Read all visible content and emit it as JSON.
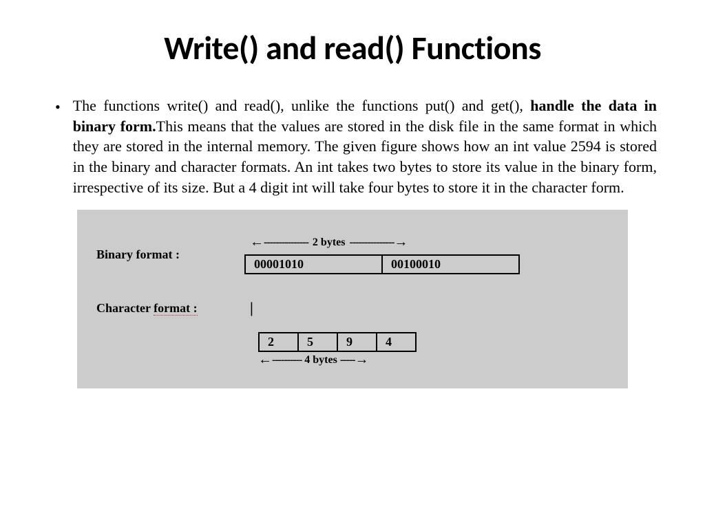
{
  "title": "Write() and read() Functions",
  "bullet": {
    "text_start": "The functions write() and read(), unlike the functions put() and get(), ",
    "text_bold": "handle the data in binary form.",
    "text_end": "This means that the values are stored in the disk file in the same format in which they are stored in the internal memory.  The given figure  shows how an int value 2594 is stored in the binary and character formats. An int takes two bytes to store its value in the binary form, irrespective of its size. But a 4 digit int will take four bytes to store it in the character form."
  },
  "figure": {
    "binary_label": "Binary format   :",
    "binary_arrow_text": "2 bytes",
    "binary_bytes": [
      "00001010",
      "00100010"
    ],
    "char_label_plain": "Character ",
    "char_label_underlined": "format :",
    "char_cells": [
      "2",
      "5",
      "9",
      "4"
    ],
    "char_arrow_text": "4 bytes",
    "arrow_left": "←",
    "arrow_right": "→",
    "dashes_long": "---------------",
    "dashes_med": "----------",
    "dashes_short": "-----",
    "cursor": "|"
  }
}
